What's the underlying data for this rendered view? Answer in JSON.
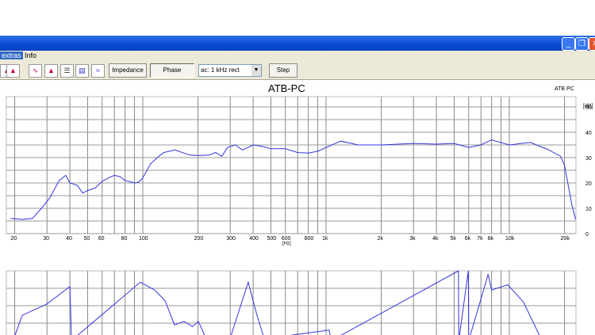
{
  "window": {
    "buttons": [
      "minimize",
      "restore",
      "close"
    ]
  },
  "menu": {
    "items": [
      "extras",
      "Info"
    ]
  },
  "toolbar": {
    "impedance": "Impedance",
    "phase": "Phase",
    "select_value": "ac: 1 kHz rect",
    "step": "Step"
  },
  "chart_data": [
    {
      "type": "line",
      "title": "ATB-PC",
      "legend": "ATB PC",
      "xlabel": "[Hz]",
      "ylabel": "[dB]",
      "xscale": "log",
      "xlim": [
        18,
        23000
      ],
      "ylim": [
        0,
        54
      ],
      "yticks": [
        "50",
        "40",
        "30",
        "20",
        "10",
        "0"
      ],
      "xticks": [
        "20",
        "30",
        "40",
        "50",
        "60",
        "80",
        "100",
        "200",
        "300",
        "400",
        "500",
        "600",
        "800",
        "1k",
        "2k",
        "3k",
        "4k",
        "5k",
        "6k",
        "7k",
        "8k",
        "10k",
        "20k"
      ],
      "series": [
        {
          "name": "ATB PC",
          "color": "#3333dd",
          "x": [
            19,
            22,
            25,
            28,
            31,
            35,
            38,
            40,
            44,
            47,
            50,
            55,
            60,
            65,
            70,
            75,
            80,
            90,
            95,
            100,
            110,
            120,
            130,
            150,
            180,
            200,
            230,
            250,
            270,
            290,
            320,
            350,
            400,
            450,
            500,
            600,
            700,
            800,
            900,
            1000,
            1200,
            1500,
            2000,
            3000,
            4000,
            5000,
            6000,
            7000,
            8000,
            10000,
            13000,
            16000,
            19000,
            20000,
            22000,
            23000
          ],
          "y": [
            6,
            5.6,
            6,
            10,
            14,
            21,
            23,
            20,
            19,
            16,
            17,
            18,
            20.6,
            22,
            23,
            22.5,
            21,
            20,
            20.3,
            22,
            27.5,
            30,
            32,
            33,
            31,
            30.8,
            31,
            32,
            30.5,
            34,
            35,
            33,
            35,
            34.4,
            33.5,
            33.5,
            32,
            31.8,
            32.5,
            34,
            36.5,
            35,
            35,
            35.6,
            35.3,
            35.6,
            34,
            35,
            37,
            35,
            36,
            33.4,
            30.6,
            27,
            11,
            5.6
          ]
        }
      ]
    },
    {
      "type": "line",
      "xscale": "log",
      "xlim": [
        18,
        23000
      ],
      "ylim": [
        0,
        4
      ],
      "series": [
        {
          "name": "lower",
          "color": "#3333dd",
          "x": [
            19.6,
            22,
            30,
            40,
            40.8,
            97,
            116,
            132,
            149,
            168,
            187,
            201,
            222,
            299,
            376,
            416,
            460,
            1040,
            1070,
            5280,
            5300,
            5970,
            6000,
            7660,
            8000,
            9800,
            11950,
            14600
          ],
          "y": [
            0,
            1.45,
            2.1,
            3.1,
            -1,
            3.35,
            2.9,
            2.3,
            0.9,
            1.1,
            0.8,
            1.1,
            0.1,
            0.1,
            3.35,
            1.6,
            0.1,
            0.6,
            -0.2,
            4,
            -1,
            4,
            -1,
            3.8,
            2.9,
            3.2,
            2.2,
            0.3
          ]
        }
      ]
    }
  ]
}
